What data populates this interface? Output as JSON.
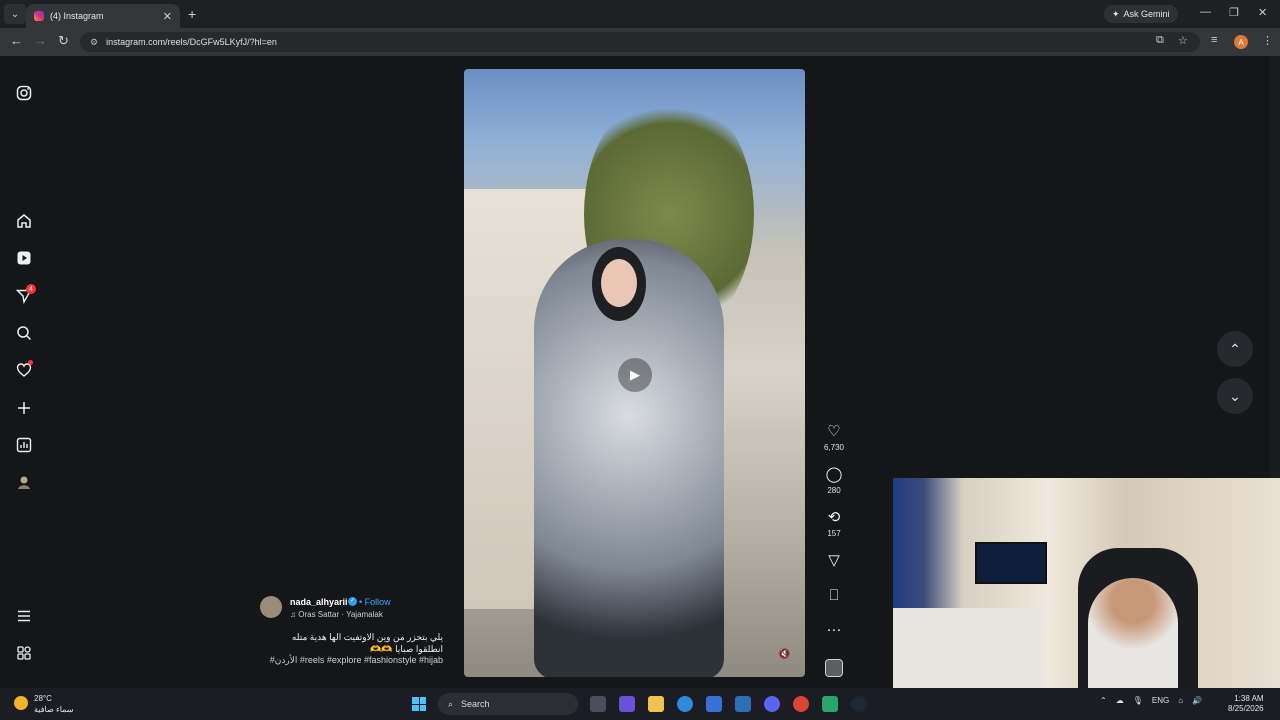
{
  "browser": {
    "tab_title": "(4) Instagram",
    "ask_gemini": "Ask Gemini",
    "url": "instagram.com/reels/DcGFw5LKyfJ/?hl=en",
    "profile_initial": "A"
  },
  "sidebar": {
    "messages_badge": "4"
  },
  "reel": {
    "username": "nada_alhyarii",
    "follow_label": "Follow",
    "audio": "Oras Sattar · Yajamalak",
    "caption_line1": "يلي بتحزر من وين الاوتفيت الها هدية متله",
    "caption_line2": "انطلقوا صبايا 🫶🫶",
    "hashtags": "#الأردن #reels #explore #fashionstyle #hijab",
    "likes": "6,730",
    "comments": "280",
    "reposts": "157"
  },
  "taskbar": {
    "temperature": "28°C",
    "weather_desc": "سماء صافية",
    "search_label": "Search",
    "language": "ENG",
    "time": "1:38 AM",
    "date": "8/25/2026"
  },
  "colors": {
    "accent_blue": "#4aa3ff",
    "badge_red": "#ff3040"
  }
}
